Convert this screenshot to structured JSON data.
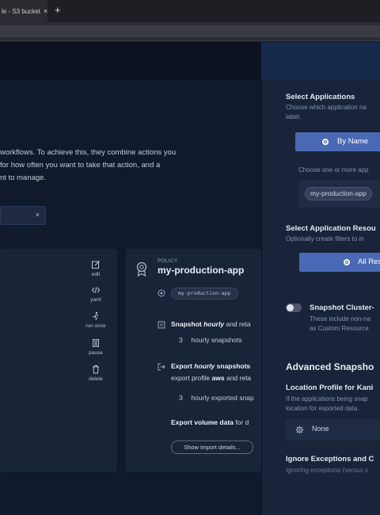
{
  "browser": {
    "tab_title": "le - S3 bucket",
    "tab_close": "×",
    "new_tab": "+"
  },
  "main": {
    "intro_lines": [
      "workflows. To achieve this, they combine actions you",
      "for how often you want to take that action, and a",
      "nt to manage."
    ],
    "filter_close": "×",
    "actions": [
      {
        "label": "edit",
        "icon": "edit-icon"
      },
      {
        "label": "yaml",
        "icon": "code-icon"
      },
      {
        "label": "run once",
        "icon": "run-icon"
      },
      {
        "label": "pause",
        "icon": "pause-icon"
      },
      {
        "label": "delete",
        "icon": "trash-icon"
      }
    ],
    "policy": {
      "eyebrow": "POLICY",
      "name": "my-production-app",
      "app_tag": "my-production-app",
      "snapshot_prefix": "Snapshot",
      "snapshot_freq": "hourly",
      "snapshot_suffix": "and reta",
      "snapshot_count": "3",
      "snapshot_count_label": "hourly snapshots",
      "export_prefix": "Export",
      "export_freq": "hourly",
      "export_suffix": "snapshots",
      "export_profile_prefix": "export profile",
      "export_profile": "aws",
      "export_profile_suffix": "and reta",
      "export_count": "3",
      "export_count_label": "hourly exported snap",
      "volume_prefix": "Export volume data",
      "volume_suffix": "for d",
      "import_button": "Show import details..."
    }
  },
  "drawer": {
    "select_apps_title": "Select Applications",
    "select_apps_desc_1": "Choose which application na",
    "select_apps_desc_2": "label.",
    "by_name_button": "By Name",
    "choose_placeholder": "Choose one or more app",
    "selected_app": "my-production-app",
    "resources_title": "Select Application Resou",
    "resources_desc": "Optionally create filters to in",
    "all_resources_button": "All Res",
    "cluster_toggle_title": "Snapshot Cluster-",
    "cluster_toggle_desc_1": "These include non-na",
    "cluster_toggle_desc_2": "as Custom Resource",
    "advanced_title": "Advanced Snapsho",
    "location_title": "Location Profile for Kani",
    "location_desc_1": "If the applications being snap",
    "location_desc_2": "location for exported data.",
    "location_value": "None",
    "ignore_title": "Ignore Exceptions and C",
    "ignore_desc": "Ignoring exceptions (versus s"
  },
  "colors": {
    "accent": "#4a69b4",
    "background": "#121a2b",
    "card": "#1a2438",
    "drawer": "#19243a"
  }
}
